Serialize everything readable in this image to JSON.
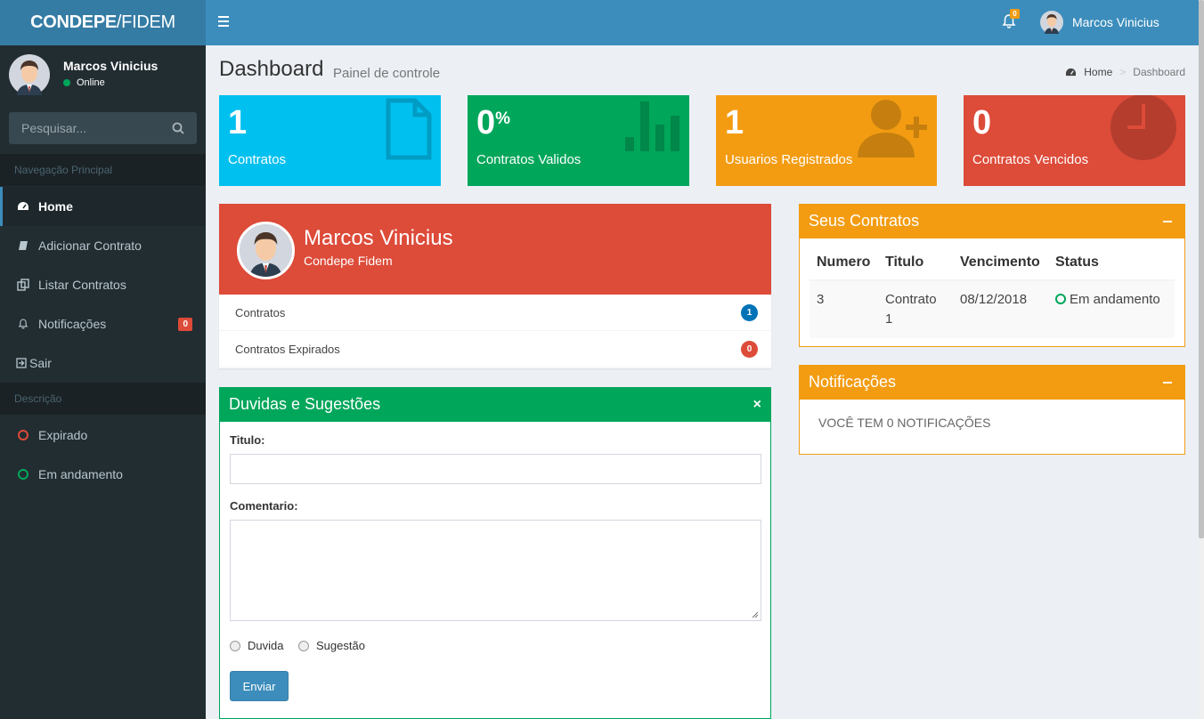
{
  "logo": {
    "bold": "CONDEPE",
    "light": "/FIDEM"
  },
  "navbar": {
    "notif_count": "0",
    "user_name": "Marcos Vinicius"
  },
  "sidebar": {
    "user_name": "Marcos Vinicius",
    "status": "Online",
    "search_placeholder": "Pesquisar...",
    "header_main": "Navegação Principal",
    "items": [
      {
        "label": "Home",
        "icon": "dashboard-icon"
      },
      {
        "label": "Adicionar Contrato",
        "icon": "book-icon"
      },
      {
        "label": "Listar Contratos",
        "icon": "copy-icon"
      },
      {
        "label": "Notificações",
        "icon": "bell-icon",
        "badge": "0"
      },
      {
        "label": "Sair",
        "icon": "sign-out-icon"
      }
    ],
    "header_desc": "Descrição",
    "legend": [
      {
        "label": "Expirado",
        "color": "#dd4b39"
      },
      {
        "label": "Em andamento",
        "color": "#00a65a"
      }
    ]
  },
  "page": {
    "title": "Dashboard",
    "subtitle": "Painel de controle"
  },
  "breadcrumb": {
    "home": "Home",
    "current": "Dashboard"
  },
  "stats": [
    {
      "value": "1",
      "suffix": "",
      "label": "Contratos",
      "color": "#00c0ef",
      "icon": "file-icon"
    },
    {
      "value": "0",
      "suffix": "%",
      "label": "Contratos Validos",
      "color": "#00a65a",
      "icon": "bar-chart-icon"
    },
    {
      "value": "1",
      "suffix": "",
      "label": "Usuarios Registrados",
      "color": "#f39c12",
      "icon": "user-plus-icon"
    },
    {
      "value": "0",
      "suffix": "",
      "label": "Contratos Vencidos",
      "color": "#dd4b39",
      "icon": "clock-icon"
    }
  ],
  "profile": {
    "name": "Marcos Vinicius",
    "org": "Condepe Fidem",
    "rows": [
      {
        "label": "Contratos",
        "count": "1",
        "color": "#0073b7"
      },
      {
        "label": "Contratos Expirados",
        "count": "0",
        "color": "#dd4b39"
      }
    ]
  },
  "form": {
    "title": "Duvidas e Sugestões",
    "close": "×",
    "title_label": "Titulo:",
    "comment_label": "Comentario:",
    "options": [
      "Duvida",
      "Sugestão"
    ],
    "submit": "Enviar"
  },
  "contracts": {
    "title": "Seus Contratos",
    "headers": [
      "Numero",
      "Titulo",
      "Vencimento",
      "Status"
    ],
    "rows": [
      {
        "numero": "3",
        "titulo": "Contrato 1",
        "vencimento": "08/12/2018",
        "status": "Em andamento"
      }
    ]
  },
  "notifications": {
    "title": "Notificações",
    "text": "VOCÊ TEM 0 NOTIFICAÇÕES"
  }
}
